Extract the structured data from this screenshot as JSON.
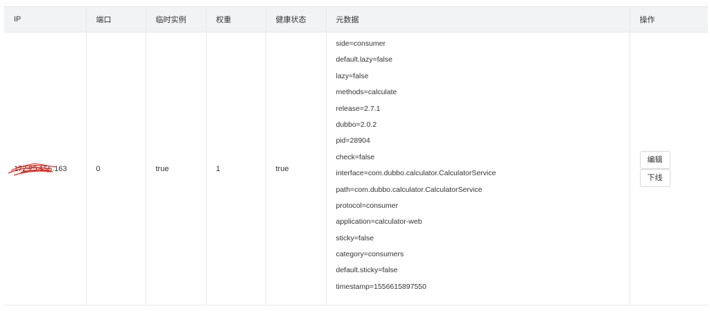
{
  "table": {
    "columns": [
      "IP",
      "端口",
      "临时实例",
      "权重",
      "健康状态",
      "元数据",
      "操作"
    ],
    "rows": [
      {
        "ip": "172.25.155.163",
        "port": "0",
        "ephemeral": "true",
        "weight": "1",
        "healthy": "true",
        "metadata": [
          "side=consumer",
          "default.lazy=false",
          "lazy=false",
          "methods=calculate",
          "release=2.7.1",
          "dubbo=2.0.2",
          "pid=28904",
          "check=false",
          "interface=com.dubbo.calculator.CalculatorService",
          "path=com.dubbo.calculator.CalculatorService",
          "protocol=consumer",
          "application=calculator-web",
          "sticky=false",
          "category=consumers",
          "default.sticky=false",
          "timestamp=1556615897550"
        ],
        "actions": {
          "edit": "编辑",
          "offline": "下线"
        }
      }
    ]
  },
  "colors": {
    "header_bg": "#f2f3f5",
    "border": "#e8e8e8",
    "redaction": "#e8261c"
  }
}
